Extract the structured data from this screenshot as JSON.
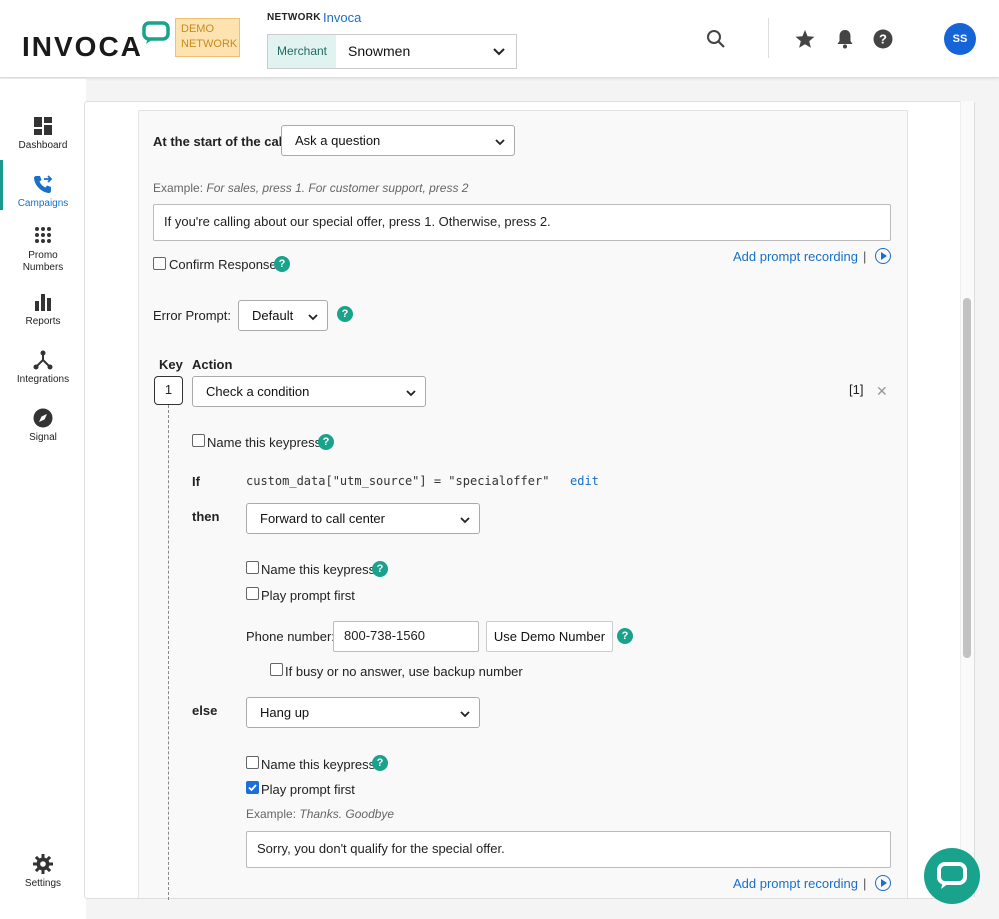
{
  "header": {
    "logo_text": "INVOCA",
    "demo_badge": "DEMO NETWORK",
    "network_label": "NETWORK",
    "network_value": "Invoca",
    "merchant_label": "Merchant",
    "merchant_value": "Snowmen",
    "avatar_initials": "SS"
  },
  "sidebar": {
    "items": [
      {
        "label": "Dashboard",
        "icon": "dashboard-icon"
      },
      {
        "label": "Campaigns",
        "icon": "campaigns-icon"
      },
      {
        "label": "Promo Numbers",
        "icon": "dialpad-icon"
      },
      {
        "label": "Reports",
        "icon": "bar-chart-icon"
      },
      {
        "label": "Integrations",
        "icon": "integrations-icon"
      },
      {
        "label": "Signal",
        "icon": "compass-icon"
      },
      {
        "label": "Settings",
        "icon": "gear-icon"
      }
    ]
  },
  "form": {
    "start_label": "At the start of the call",
    "start_value": "Ask a question",
    "example1_prefix": "Example:",
    "example1_text": "For sales, press 1. For customer support, press 2",
    "prompt1_value": "If you're calling about our special offer, press 1. Otherwise, press 2.",
    "confirm_label": "Confirm Response",
    "add_prompt_label": "Add prompt recording",
    "sep": "|",
    "error_label": "Error Prompt:",
    "error_value": "Default",
    "key_header": "Key",
    "action_header": "Action",
    "key_value": "1",
    "action_value": "Check a condition",
    "key_ref": "[1]",
    "remove_glyph": "✕",
    "name_keypress_label": "Name this keypress",
    "if_label": "If",
    "condition_code": "custom_data[\"utm_source\"] = \"specialoffer\"",
    "edit_label": "edit",
    "then_label": "then",
    "then_value": "Forward to call center",
    "play_prompt_label": "Play prompt first",
    "phone_label": "Phone number:",
    "phone_value": "800-738-1560",
    "demo_number_button": "Use Demo Number",
    "backup_label": "If busy or no answer, use backup number",
    "else_label": "else",
    "else_value": "Hang up",
    "example2_prefix": "Example:",
    "example2_text": "Thanks. Goodbye",
    "prompt2_value": "Sorry, you don't qualify for the special offer."
  },
  "colors": {
    "accent_teal": "#1aa38c",
    "link_blue": "#1a6fc9",
    "avatar_blue": "#1565d8",
    "demo_badge_bg": "#fde3b0"
  }
}
